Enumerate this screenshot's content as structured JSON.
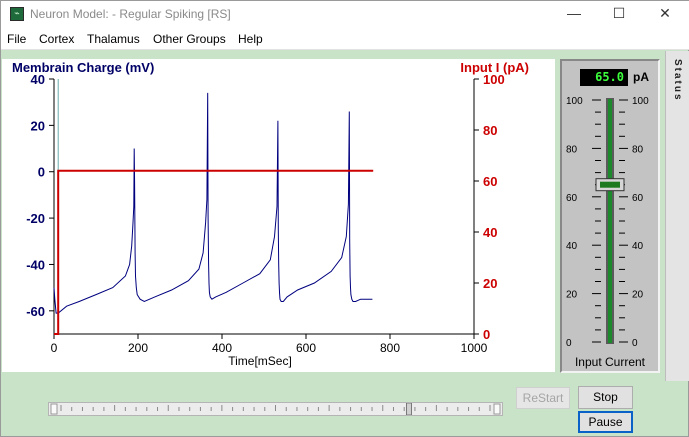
{
  "window": {
    "title": "Neuron Model:  - Regular Spiking [RS]",
    "icon": "app-icon",
    "caption": {
      "minimize": "—",
      "maximize": "☐",
      "close": "✕"
    }
  },
  "menu": [
    "File",
    "Cortex",
    "Thalamus",
    "Other Groups",
    "Help"
  ],
  "colors": {
    "membrane": "#00007f",
    "current": "#cc0000",
    "left_axis": "#000066",
    "right_axis": "#cc0000",
    "panel_green": "#c9e3c9"
  },
  "chart_data": {
    "type": "line",
    "left_title": "Membrain Charge (mV)",
    "right_title": "Input I (pA)",
    "xlabel": "Time[mSec]",
    "xlim": [
      0,
      1000
    ],
    "xticks": [
      0,
      200,
      400,
      600,
      800,
      1000
    ],
    "ylim_left": [
      -70,
      40
    ],
    "yticks_left": [
      40,
      20,
      0,
      -20,
      -40,
      -60
    ],
    "ylim_right": [
      0,
      100
    ],
    "yticks_right": [
      100,
      80,
      60,
      40,
      20,
      0
    ],
    "grid": false,
    "series": [
      {
        "axis": "left",
        "x": [
          0,
          2,
          5,
          10,
          30,
          60,
          100,
          140,
          170,
          180,
          185,
          188,
          190,
          191,
          192,
          193,
          194,
          196,
          198,
          205,
          215,
          240,
          280,
          320,
          345,
          355,
          361,
          364,
          366,
          367,
          368,
          369,
          370,
          372,
          376,
          385,
          410,
          450,
          490,
          515,
          525,
          531,
          533,
          534,
          535,
          536,
          537,
          538,
          541,
          546,
          555,
          580,
          620,
          660,
          685,
          696,
          701,
          703,
          704,
          705,
          706,
          707,
          709,
          712,
          718,
          730,
          745,
          758
        ],
        "y": [
          -50,
          -55,
          -61,
          -61,
          -58,
          -56,
          -53,
          -50,
          -45,
          -40,
          -32,
          -22,
          -15,
          10,
          -5,
          -35,
          -45,
          -50,
          -53,
          -55,
          -56,
          -54,
          -51,
          -47,
          -42,
          -35,
          -22,
          -12,
          34,
          -20,
          -40,
          -48,
          -52,
          -54,
          -55,
          -54,
          -52,
          -48,
          -44,
          -38,
          -28,
          -15,
          22,
          -25,
          -40,
          -48,
          -52,
          -55,
          -56,
          -56,
          -54,
          -51,
          -48,
          -43,
          -37,
          -28,
          -14,
          26,
          -30,
          -45,
          -50,
          -53,
          -55,
          -56,
          -56,
          -55,
          -55,
          -55
        ]
      },
      {
        "axis": "right",
        "x": [
          0,
          10,
          10,
          760
        ],
        "y": [
          0,
          0,
          64,
          64
        ]
      }
    ]
  },
  "slider": {
    "value_display": "65.0",
    "unit": "pA",
    "label": "Input Current",
    "scale": [
      100,
      80,
      60,
      40,
      20,
      0
    ],
    "range": [
      0,
      100
    ],
    "value": 65
  },
  "status": {
    "label": "Status"
  },
  "controls": {
    "restart": "ReStart",
    "stop": "Stop",
    "pause": "Pause",
    "scroll_position": 0.81
  }
}
